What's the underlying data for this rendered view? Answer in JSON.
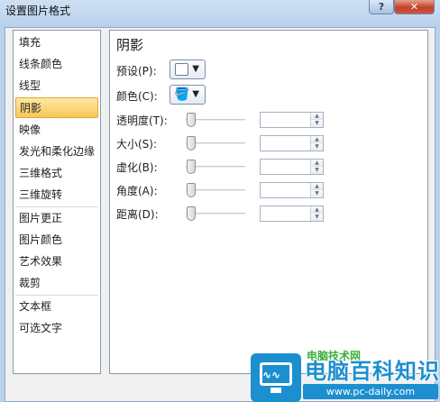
{
  "window": {
    "title": "设置图片格式",
    "help_label": "?",
    "close_label": "✕"
  },
  "sidebar": {
    "items": [
      {
        "label": "填充"
      },
      {
        "label": "线条颜色"
      },
      {
        "label": "线型"
      },
      {
        "label": "阴影",
        "selected": true
      },
      {
        "label": "映像"
      },
      {
        "label": "发光和柔化边缘"
      },
      {
        "label": "三维格式"
      },
      {
        "label": "三维旋转"
      },
      {
        "label": "图片更正"
      },
      {
        "label": "图片颜色"
      },
      {
        "label": "艺术效果"
      },
      {
        "label": "裁剪"
      },
      {
        "label": "文本框"
      },
      {
        "label": "可选文字"
      }
    ]
  },
  "panel": {
    "section_title": "阴影",
    "preset": {
      "label": "预设(P):",
      "icon": "shadow-preset-icon"
    },
    "color": {
      "label": "颜色(C):",
      "icon": "paint-bucket-icon"
    },
    "sliders": [
      {
        "label": "透明度(T):",
        "value": "",
        "level": 0
      },
      {
        "label": "大小(S):",
        "value": "",
        "level": 0
      },
      {
        "label": "虚化(B):",
        "value": "",
        "level": 0
      },
      {
        "label": "角度(A):",
        "value": "",
        "level": 0
      },
      {
        "label": "距离(D):",
        "value": "",
        "level": 0
      }
    ]
  },
  "watermark": {
    "title": "电脑百科知识",
    "url": "www.pc-daily.com",
    "green_text": "电脑技术网"
  }
}
